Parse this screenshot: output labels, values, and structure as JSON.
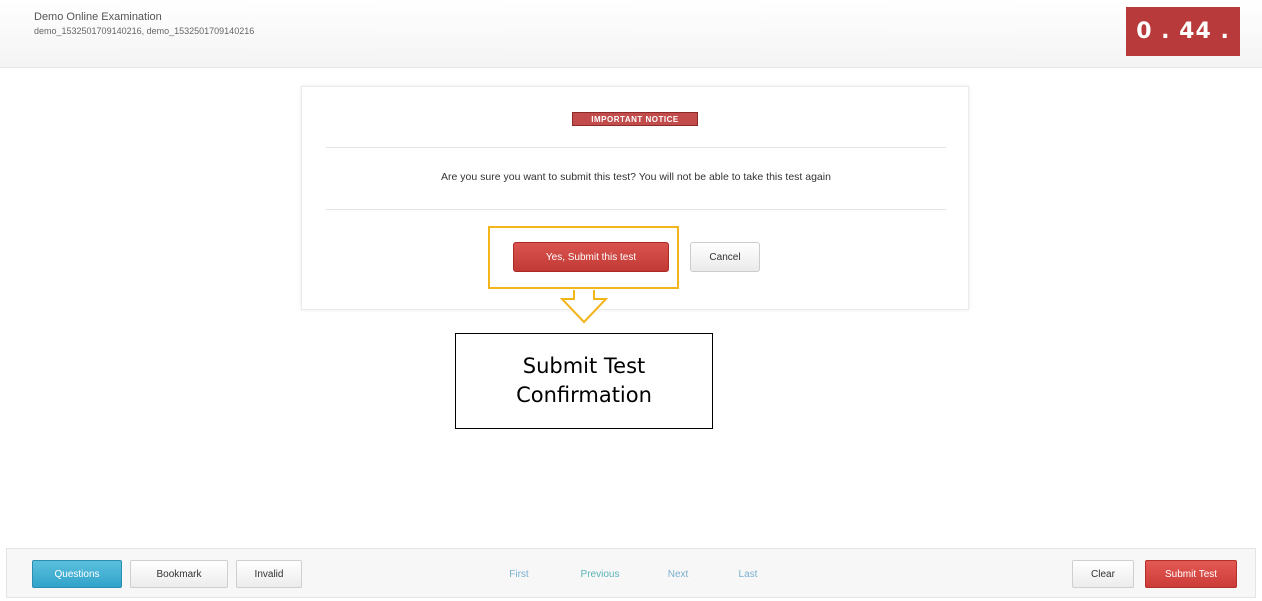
{
  "header": {
    "exam_title": "Demo Online Examination",
    "user_line": "demo_1532501709140216, demo_1532501709140216",
    "timer": "0 . 44 ."
  },
  "dialog": {
    "badge": "IMPORTANT NOTICE",
    "message": "Are you sure you want to submit this test? You will not be able to take this test again",
    "confirm_label": "Yes, Submit this test",
    "cancel_label": "Cancel"
  },
  "annotation": {
    "line1": "Submit Test",
    "line2": "Confirmation",
    "highlight_color": "#f2b51c"
  },
  "footer": {
    "questions_label": "Questions",
    "bookmark_label": "Bookmark",
    "invalid_label": "Invalid",
    "first_label": "First",
    "previous_label": "Previous",
    "next_label": "Next",
    "last_label": "Last",
    "clear_label": "Clear",
    "submit_label": "Submit Test"
  },
  "colors": {
    "timer_bg": "#b83a3a",
    "danger": "#d9534f",
    "info": "#5bc0de"
  }
}
